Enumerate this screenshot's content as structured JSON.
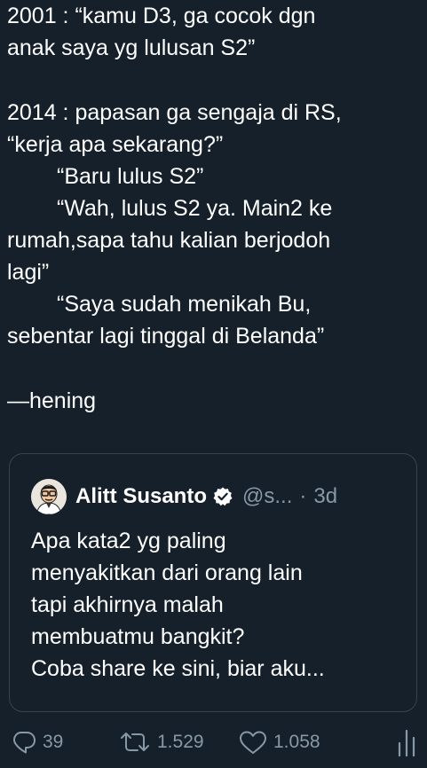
{
  "tweet": {
    "lines": [
      "2001 : “kamu D3, ga cocok dgn",
      "anak saya yg lulusan S2”",
      "2014 : papasan ga sengaja di RS,",
      "“kerja apa sekarang?”",
      "“Baru lulus S2”",
      "“Wah, lulus S2 ya. Main2 ke",
      "rumah,sapa tahu kalian berjodoh",
      "lagi”",
      "“Saya sudah menikah Bu,",
      "sebentar lagi tinggal di Belanda”",
      "—hening"
    ]
  },
  "quote": {
    "name": "Alitt Susanto",
    "handle": "@s...",
    "separator": "·",
    "time": "3d",
    "avatar_icon": "avatar-illustration",
    "verified_icon": "verified-badge-icon",
    "lines": [
      "Apa kata2 yg paling",
      "menyakitkan dari orang lain",
      "tapi akhirnya malah",
      "membuatmu bangkit?",
      "Coba share ke sini, biar aku..."
    ]
  },
  "actions": {
    "replies": "39",
    "retweets": "1.529",
    "likes": "1.058",
    "reply_icon": "reply-icon",
    "retweet_icon": "retweet-icon",
    "like_icon": "heart-icon",
    "stats_icon": "stats-icon"
  },
  "colors": {
    "background": "#15202b",
    "text": "#ffffff",
    "muted": "#8899a6",
    "border": "#38444d"
  }
}
